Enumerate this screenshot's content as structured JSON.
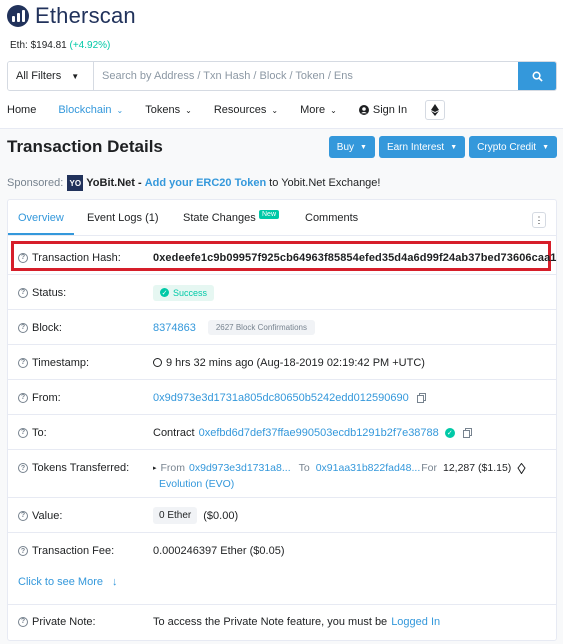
{
  "brand": {
    "name": "Etherscan"
  },
  "eth_price": {
    "label": "Eth: $194.81",
    "change": "(+4.92%)"
  },
  "search": {
    "filter": "All Filters",
    "placeholder": "Search by Address / Txn Hash / Block / Token / Ens",
    "icon": "search-icon"
  },
  "nav": {
    "home": "Home",
    "blockchain": "Blockchain",
    "tokens": "Tokens",
    "resources": "Resources",
    "more": "More",
    "sign_in": "Sign In"
  },
  "page": {
    "title": "Transaction Details"
  },
  "actions": {
    "buy": "Buy",
    "earn": "Earn Interest",
    "crypto": "Crypto Credit"
  },
  "sponsor": {
    "label": "Sponsored:",
    "badge": "YO",
    "brand": "YoBit.Net",
    "dash": " - ",
    "link": "Add your ERC20 Token",
    "tail": "to Yobit.Net Exchange!"
  },
  "tabs": {
    "overview": "Overview",
    "event_logs": "Event Logs (1)",
    "state_changes": "State Changes",
    "new_badge": "New",
    "comments": "Comments"
  },
  "details": {
    "tx_hash": {
      "label": "Transaction Hash:",
      "value": "0xedeefe1c9b09957f925cb64963f85854efed35d4a6d99f24ab37bed73606caa1"
    },
    "status": {
      "label": "Status:",
      "value": "Success"
    },
    "block": {
      "label": "Block:",
      "value": "8374863",
      "confirmations": "2627 Block Confirmations"
    },
    "timestamp": {
      "label": "Timestamp:",
      "value": "9 hrs 32 mins ago (Aug-18-2019 02:19:42 PM +UTC)"
    },
    "from": {
      "label": "From:",
      "value": "0x9d973e3d1731a805dc80650b5242edd012590690"
    },
    "to": {
      "label": "To:",
      "prefix": "Contract",
      "value": "0xefbd6d7def37ffae990503ecdb1291b2f7e38788"
    },
    "tokens": {
      "label": "Tokens Transferred:",
      "from_label": "From",
      "from": "0x9d973e3d1731a8...",
      "to_label": "To",
      "to": "0x91aa31b822fad48...",
      "for_label": "For",
      "amount": "12,287 ($1.15)",
      "token": "Evolution (EVO)"
    },
    "value": {
      "label": "Value:",
      "value": "0 Ether",
      "usd": "($0.00)"
    },
    "fee": {
      "label": "Transaction Fee:",
      "value": "0.000246397 Ether ($0.05)"
    },
    "click_more": "Click to see More",
    "private_note": {
      "label": "Private Note:",
      "text": "To access the Private Note feature, you must be",
      "link": "Logged In"
    }
  }
}
